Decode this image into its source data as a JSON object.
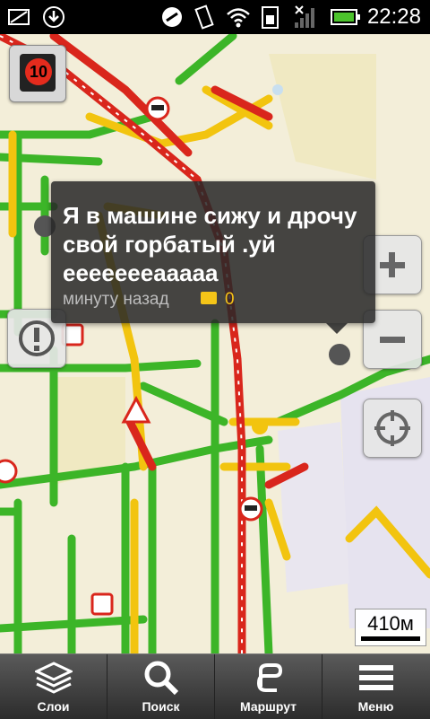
{
  "statusbar": {
    "time": "22:28"
  },
  "traffic": {
    "level": "10",
    "color": "#e52b1d"
  },
  "popup": {
    "message": "Я в машине сижу и дрочу свой горбатый .уй ееееееeaaaaa",
    "time_ago": "минуту назад",
    "comment_count": "0"
  },
  "scale": {
    "label": "410м"
  },
  "toolbar": {
    "layers": "Слои",
    "search": "Поиск",
    "route": "Маршрут",
    "menu": "Меню"
  },
  "colors": {
    "jam_red": "#d9261c",
    "slow_yellow": "#f2c40f",
    "free_green": "#3cb528",
    "map_bg": "#f3eed9"
  }
}
